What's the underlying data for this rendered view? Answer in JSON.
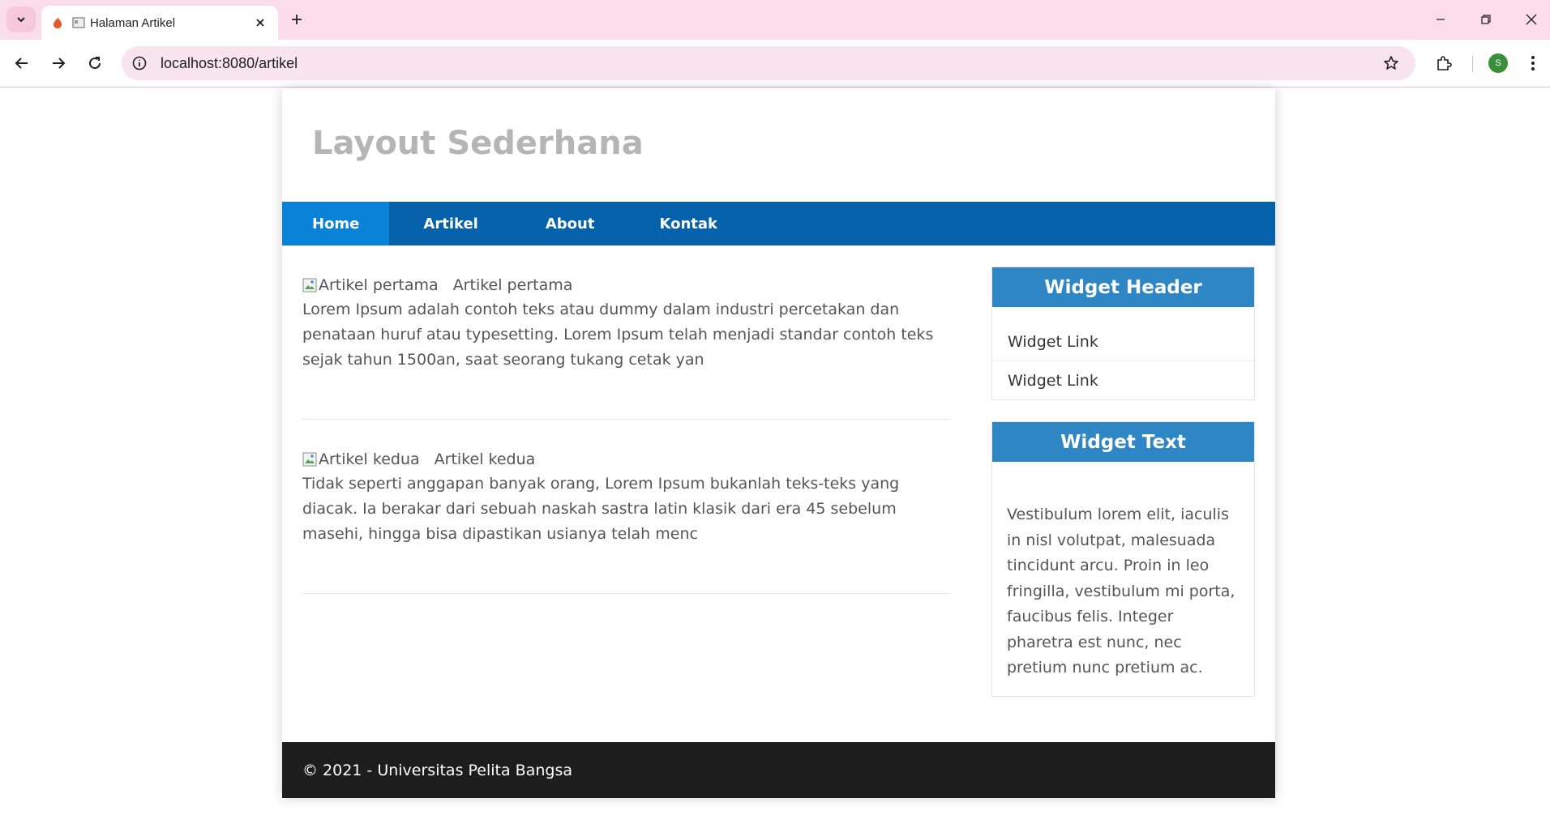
{
  "browser": {
    "tab_title": "Halaman Artikel",
    "url": "localhost:8080/artikel",
    "profile_initial": "S"
  },
  "page": {
    "site_title": "Layout Sederhana",
    "nav": [
      {
        "label": "Home",
        "active": true
      },
      {
        "label": "Artikel",
        "active": false
      },
      {
        "label": "About",
        "active": false
      },
      {
        "label": "Kontak",
        "active": false
      }
    ],
    "articles": [
      {
        "img_alt": "Artikel pertama",
        "title": "Artikel pertama",
        "body": "Lorem Ipsum adalah contoh teks atau dummy dalam industri percetakan dan penataan huruf atau typesetting. Lorem Ipsum telah menjadi standar contoh teks sejak tahun 1500an, saat seorang tukang cetak yan"
      },
      {
        "img_alt": "Artikel kedua",
        "title": "Artikel kedua",
        "body": "Tidak seperti anggapan banyak orang, Lorem Ipsum bukanlah teks-teks yang diacak. Ia berakar dari sebuah naskah sastra latin klasik dari era 45 sebelum masehi, hingga bisa dipastikan usianya telah menc"
      }
    ],
    "widgets": {
      "links_header": "Widget Header",
      "links": [
        "Widget Link",
        "Widget Link"
      ],
      "text_header": "Widget Text",
      "text_body": "Vestibulum lorem elit, iaculis in nisl volutpat, malesuada tincidunt arcu. Proin in leo fringilla, vestibulum mi porta, faucibus felis. Integer pharetra est nunc, nec pretium nunc pretium ac."
    },
    "footer": "© 2021 - Universitas Pelita Bangsa"
  },
  "colors": {
    "tabbar_bg": "#fbdcea",
    "nav_bg": "#0561a9",
    "nav_active": "#0a82d8",
    "widget_header": "#2f86c4",
    "footer_bg": "#1d1d1d"
  }
}
